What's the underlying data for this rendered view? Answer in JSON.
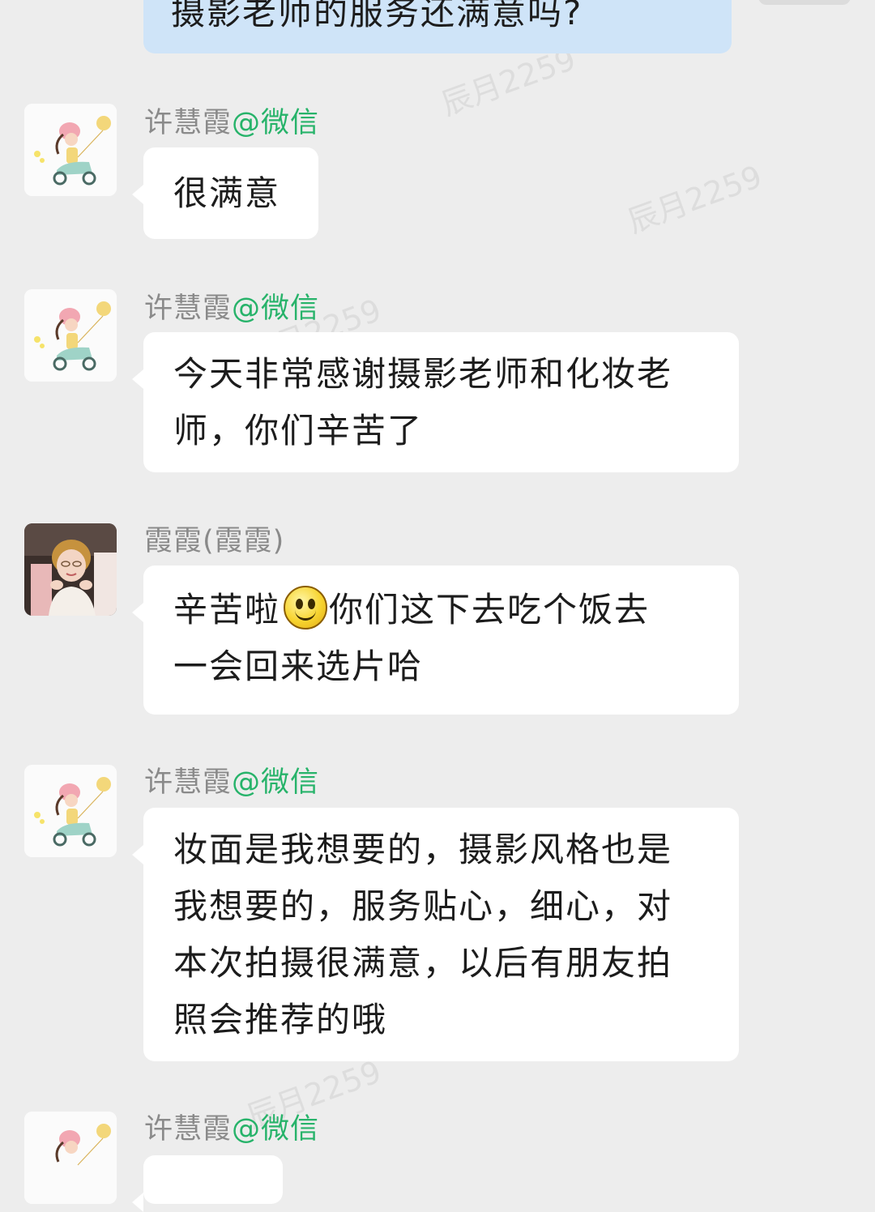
{
  "messages": [
    {
      "text": "摄影老师的服务还满意吗?"
    },
    {
      "sender": "许慧霞",
      "suffix": "@微信",
      "text": "很满意"
    },
    {
      "sender": "许慧霞",
      "suffix": "@微信",
      "lines": [
        "今天非常感谢摄影老师和化妆老",
        "师，你们辛苦了"
      ]
    },
    {
      "sender": "霞霞(霞霞)",
      "suffix": "",
      "line1_before": "辛苦啦",
      "line1_after": "你们这下去吃个饭去",
      "line2": "一会回来选片哈"
    },
    {
      "sender": "许慧霞",
      "suffix": "@微信",
      "lines": [
        "妆面是我想要的，摄影风格也是",
        "我想要的，服务贴心，细心，对",
        "本次拍摄很满意，以后有朋友拍",
        "照会推荐的哦"
      ]
    },
    {
      "sender": "许慧霞",
      "suffix": "@微信"
    }
  ],
  "watermark": "辰月2259",
  "icons": {
    "cartoon_avatar": "girl-on-scooter-avatar-icon",
    "photo_avatar": "woman-portrait-avatar-icon",
    "emoji": "smile-emoji-icon"
  },
  "colors": {
    "background": "#ededed",
    "bubble": "#ffffff",
    "self_bubble": "#cfe4f8",
    "suffix": "#27b36a"
  }
}
